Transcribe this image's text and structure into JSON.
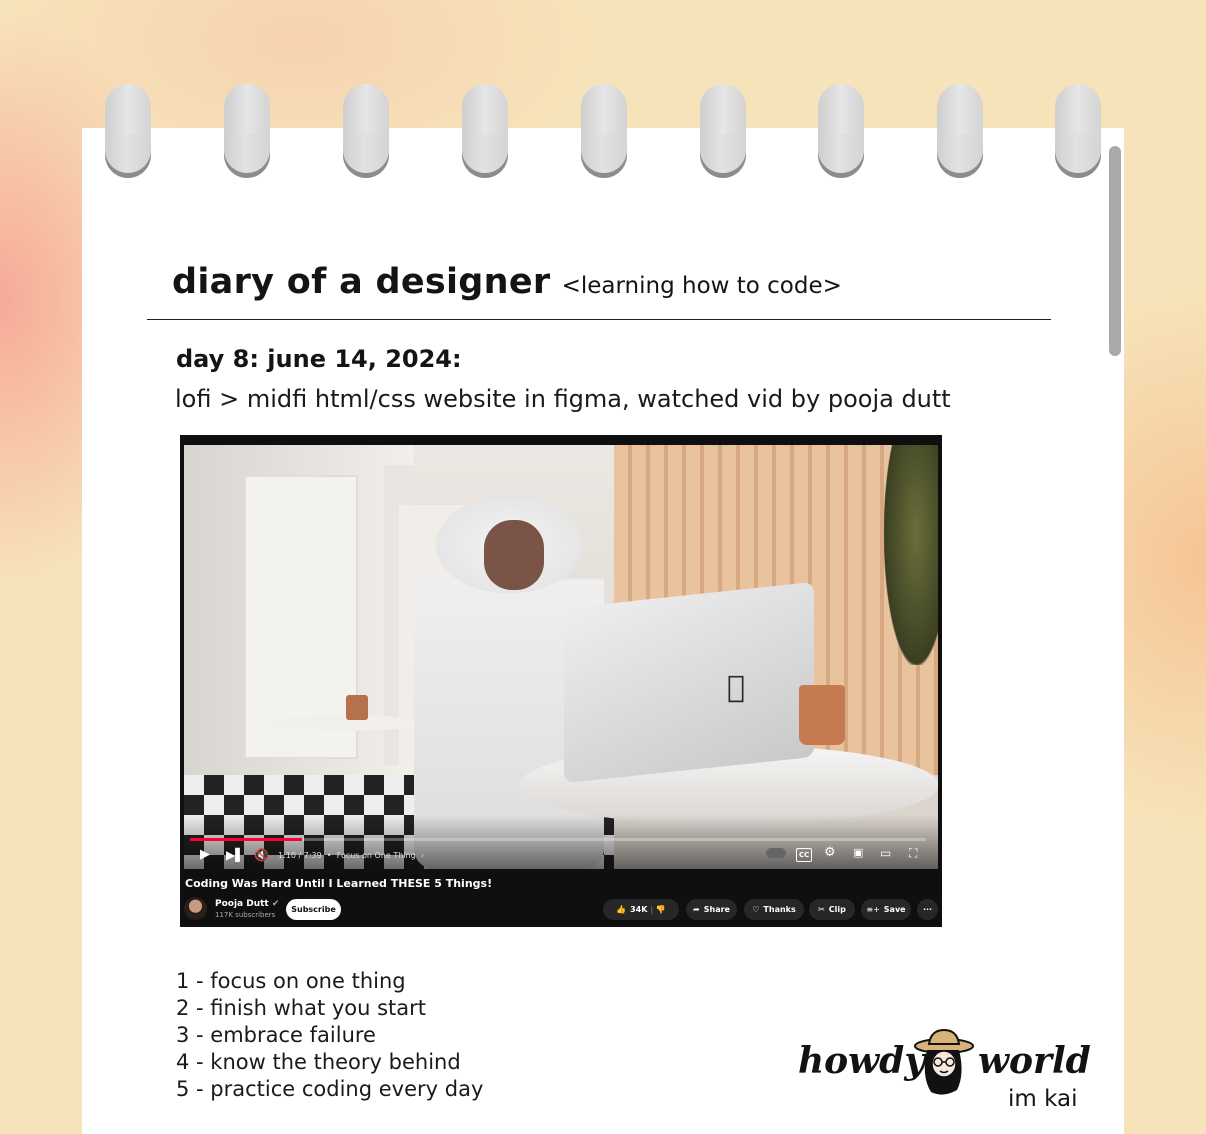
{
  "header": {
    "title": "diary of a designer",
    "subtitle": "<learning how to code>"
  },
  "entry": {
    "heading": "day 8: june 14, 2024:",
    "description": "lofi > midfi html/css website in figma, watched vid by pooja dutt"
  },
  "video": {
    "title": "Coding Was Hard Until I Learned THESE 5 Things!",
    "time": "1:10 / 7:39",
    "chapter": "Focus on One Thing",
    "progress": 0.152,
    "channel_name": "Pooja Dutt",
    "subscribers": "117K subscribers",
    "subscribe_label": "Subscribe",
    "likes": "34K",
    "share_label": "Share",
    "thanks_label": "Thanks",
    "clip_label": "Clip",
    "save_label": "Save",
    "cc_label": "CC",
    "more_label": "···"
  },
  "list": [
    "1 - focus on one thing",
    "2 - finish what you start",
    "3 - embrace failure",
    "4 - know the theory behind",
    "5 - practice coding every day"
  ],
  "logo": {
    "left": "howdy",
    "right": "world",
    "sub": "im kai"
  },
  "colors": {
    "background": "#f7e3b9",
    "paper": "#ffffff",
    "progress": "#ff0033"
  }
}
